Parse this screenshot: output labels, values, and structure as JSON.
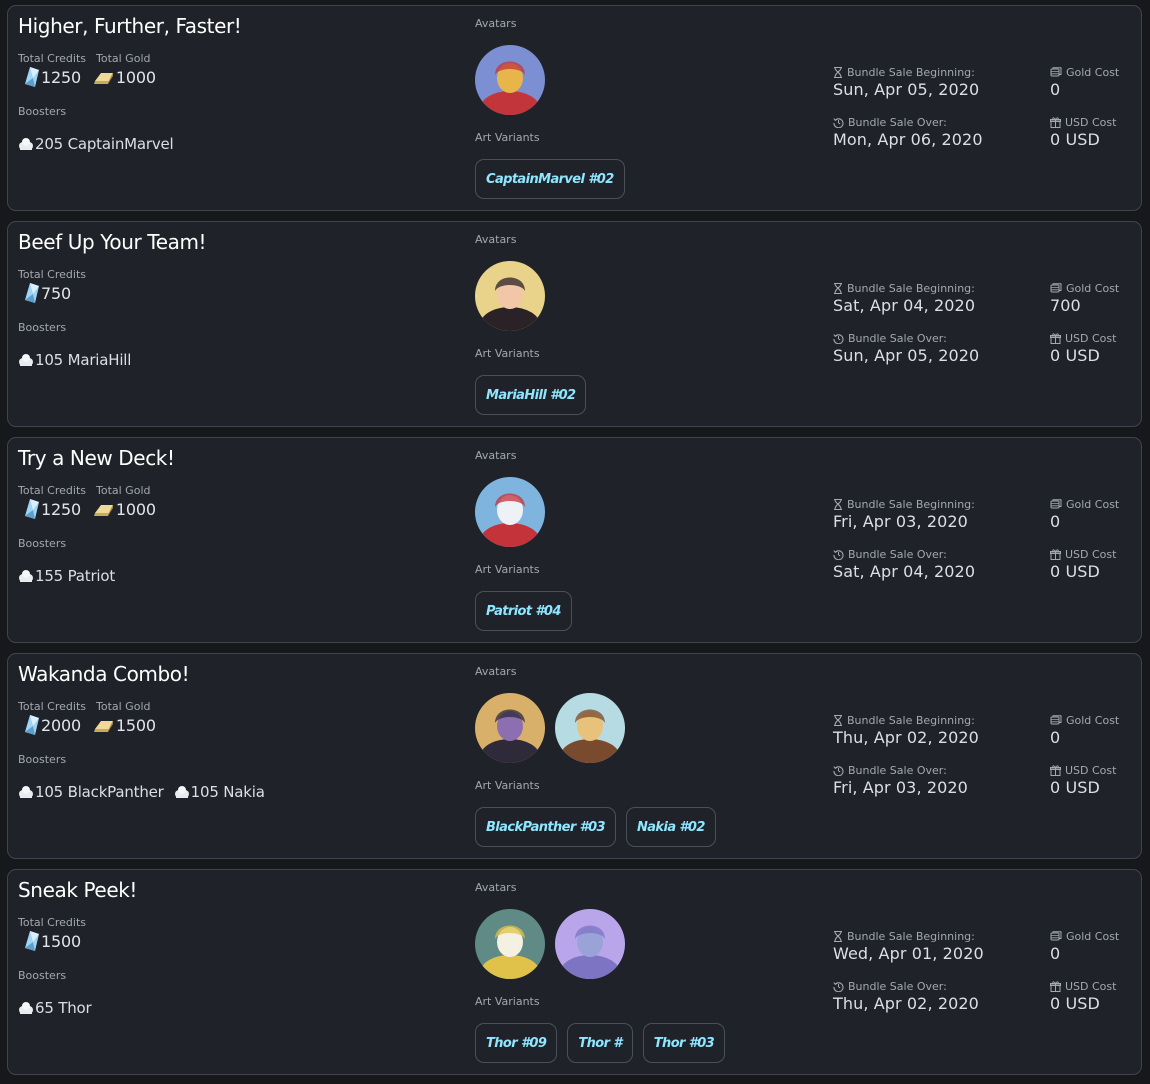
{
  "labels": {
    "total_credits": "Total Credits",
    "total_gold": "Total Gold",
    "boosters": "Boosters",
    "avatars": "Avatars",
    "art_variants": "Art Variants",
    "bundle_sale_beginning": "Bundle Sale Beginning:",
    "bundle_sale_over": "Bundle Sale Over:",
    "gold_cost": "Gold Cost",
    "usd_cost": "USD Cost"
  },
  "colors": {
    "background": "#16181c",
    "card": "#1f2228",
    "card_border": "#3f444d",
    "variant_text": "#8ee6ff",
    "credits_icon": "#9fd4f5",
    "gold_icon": "#f0d89a"
  },
  "bundles": [
    {
      "title": "Higher, Further, Faster!",
      "credits": "1250",
      "gold": "1000",
      "boosters": [
        {
          "count_name": "205 CaptainMarvel"
        }
      ],
      "avatars": [
        {
          "icon": "captain-marvel-avatar",
          "bg": "#7c8fd2",
          "accent": "#e8b54a",
          "suit": "#c2363b"
        }
      ],
      "art_variants": [
        "CaptainMarvel #02"
      ],
      "sale_beginning": "Sun, Apr 05, 2020",
      "sale_over": "Mon, Apr 06, 2020",
      "gold_cost": "0",
      "usd_cost": "0 USD"
    },
    {
      "title": "Beef Up Your Team!",
      "credits": "750",
      "gold": null,
      "boosters": [
        {
          "count_name": "105 MariaHill"
        }
      ],
      "avatars": [
        {
          "icon": "maria-hill-avatar",
          "bg": "#e9d38a",
          "accent": "#f1c7a8",
          "suit": "#2a2226"
        }
      ],
      "art_variants": [
        "MariaHill #02"
      ],
      "sale_beginning": "Sat, Apr 04, 2020",
      "sale_over": "Sun, Apr 05, 2020",
      "gold_cost": "700",
      "usd_cost": "0 USD"
    },
    {
      "title": "Try a New Deck!",
      "credits": "1250",
      "gold": "1000",
      "boosters": [
        {
          "count_name": "155 Patriot"
        }
      ],
      "avatars": [
        {
          "icon": "patriot-avatar",
          "bg": "#7fb4df",
          "accent": "#eef2f6",
          "suit": "#c4323a"
        }
      ],
      "art_variants": [
        "Patriot #04"
      ],
      "sale_beginning": "Fri, Apr 03, 2020",
      "sale_over": "Sat, Apr 04, 2020",
      "gold_cost": "0",
      "usd_cost": "0 USD"
    },
    {
      "title": "Wakanda Combo!",
      "credits": "2000",
      "gold": "1500",
      "boosters": [
        {
          "count_name": "105 BlackPanther"
        },
        {
          "count_name": "105 Nakia"
        }
      ],
      "avatars": [
        {
          "icon": "black-panther-avatar",
          "bg": "#d9b06a",
          "accent": "#8c6fb0",
          "suit": "#2e2a3a"
        },
        {
          "icon": "nakia-avatar",
          "bg": "#b7dbe3",
          "accent": "#e8c27a",
          "suit": "#7a4a2e"
        }
      ],
      "art_variants": [
        "BlackPanther #03",
        "Nakia #02"
      ],
      "sale_beginning": "Thu, Apr 02, 2020",
      "sale_over": "Fri, Apr 03, 2020",
      "gold_cost": "0",
      "usd_cost": "0 USD"
    },
    {
      "title": "Sneak Peek!",
      "credits": "1500",
      "gold": null,
      "boosters": [
        {
          "count_name": "65 Thor"
        }
      ],
      "avatars": [
        {
          "icon": "thor-avatar",
          "bg": "#5f8a86",
          "accent": "#f4f1e3",
          "suit": "#e0c24a"
        },
        {
          "icon": "thor-variant-avatar",
          "bg": "#b9a6ea",
          "accent": "#9aa3d8",
          "suit": "#7e74c4"
        }
      ],
      "art_variants": [
        "Thor #09",
        "Thor #",
        "Thor #03"
      ],
      "sale_beginning": "Wed, Apr 01, 2020",
      "sale_over": "Thu, Apr 02, 2020",
      "gold_cost": "0",
      "usd_cost": "0 USD"
    }
  ]
}
